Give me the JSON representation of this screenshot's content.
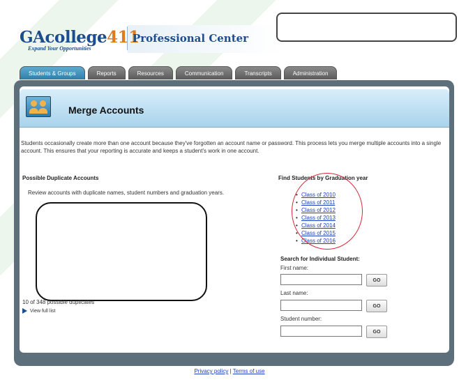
{
  "brand": {
    "logo_main": "GAcollege",
    "logo_num": "411",
    "tagline": "Expand Your Opportunities",
    "center": "Professional Center"
  },
  "tabs": [
    "Students & Groups",
    "Reports",
    "Resources",
    "Communication",
    "Transcripts",
    "Administration"
  ],
  "page": {
    "title": "Merge Accounts",
    "intro": "Students occasionally create more than one account because they've forgotten an account name or password. This process lets you merge multiple accounts into a single account. This ensures that your reporting is accurate and keeps a student's work in one account."
  },
  "duplicates": {
    "heading": "Possible Duplicate Accounts",
    "review_text": "Review accounts with duplicate names, student numbers and graduation years.",
    "count_text": "10 of 348 possible duplicates",
    "view_full": "View full list"
  },
  "graduation": {
    "heading": "Find Students by Graduation year",
    "years": [
      "Class of 2010",
      "Class of 2011",
      "Class of 2012",
      "Class of 2013",
      "Class of 2014",
      "Class of 2015",
      "Class of 2016"
    ]
  },
  "search": {
    "heading": "Search for Individual Student:",
    "first_name_label": "First name:",
    "last_name_label": "Last name:",
    "student_number_label": "Student number:",
    "go_label": "GO"
  },
  "footer": {
    "privacy": "Privacy policy",
    "separator": "|",
    "terms": "Terms of use"
  },
  "colors": {
    "brand_blue": "#1d4d8c",
    "brand_orange": "#e07b1d",
    "highlight_red": "#d8273a",
    "active_tab": "#2f7eaa"
  }
}
